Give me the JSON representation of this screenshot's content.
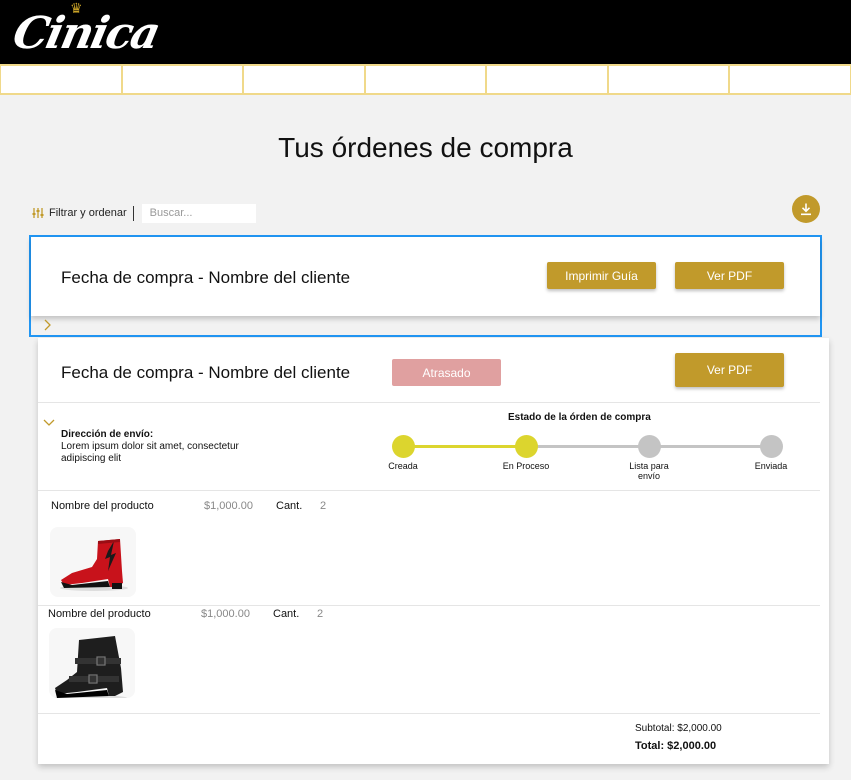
{
  "brand": {
    "logo_text": "Cinica"
  },
  "nav": {
    "items": [
      "",
      "",
      "",
      "",
      "",
      "",
      ""
    ]
  },
  "page": {
    "title": "Tus órdenes de compra"
  },
  "toolbar": {
    "filter_label": "Filtrar y ordenar",
    "search_placeholder": "Buscar...",
    "download_icon": "download-icon"
  },
  "orders": [
    {
      "title": "Fecha de compra - Nombre del cliente",
      "print_label": "Imprimir Guía",
      "pdf_label": "Ver PDF",
      "expanded": false
    },
    {
      "title": "Fecha de compra - Nombre del cliente",
      "status_badge": "Atrasado",
      "pdf_label": "Ver PDF",
      "expanded": true,
      "shipping": {
        "label": "Dirección de envío:",
        "address": "Lorem ipsum dolor sit amet, consectetur adipiscing elit"
      },
      "status": {
        "title": "Estado de la órden de compra",
        "steps": [
          {
            "label": "Creada",
            "done": true
          },
          {
            "label": "En Proceso",
            "done": true
          },
          {
            "label": "Lista para envío",
            "done": false
          },
          {
            "label": "Enviada",
            "done": false
          }
        ]
      },
      "products": [
        {
          "name": "Nombre del producto",
          "price": "$1,000.00",
          "qty_label": "Cant.",
          "qty": "2",
          "image": "red-ankle-boot"
        },
        {
          "name": "Nombre del producto",
          "price": "$1,000.00",
          "qty_label": "Cant.",
          "qty": "2",
          "image": "black-buckle-boot"
        }
      ],
      "subtotal": "Subtotal: $2,000.00",
      "total": "Total: $2,000.00"
    }
  ],
  "colors": {
    "gold": "#c19a2b",
    "nav_border": "#f0d98a",
    "late": "#e0a0a0",
    "progress_done": "#dcd52e",
    "progress_pending": "#c4c4c4",
    "selection": "#2196f3"
  }
}
